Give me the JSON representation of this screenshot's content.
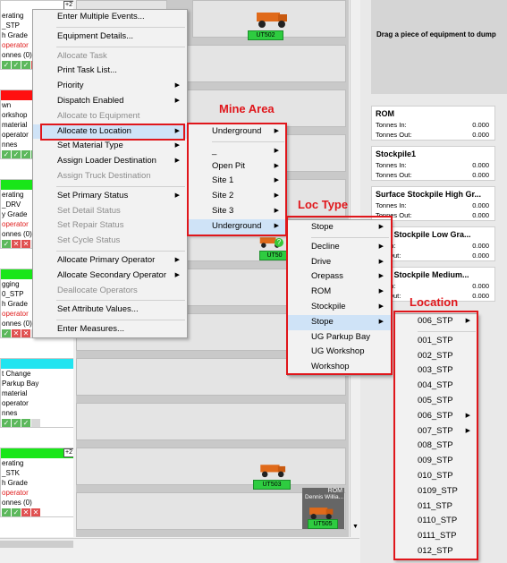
{
  "left_cards": [
    {
      "header_color": "#ffffff",
      "lines": [
        "erating",
        "_STP",
        "h Grade",
        "operator",
        "onnes (0)"
      ],
      "red_line": 3,
      "badge": "+2",
      "icons": [
        "g",
        "g",
        "g",
        "r"
      ]
    },
    {
      "header_color": "#ff1010",
      "lines": [
        "wn",
        "orkshop",
        "material",
        "operator",
        "nnes"
      ],
      "red_line": -1,
      "badge": "",
      "icons": [
        "g",
        "g",
        "g",
        "g"
      ]
    },
    {
      "header_color": "#19e619",
      "lines": [
        "erating",
        "_DRV",
        "y Grade",
        "operator",
        "onnes (0)"
      ],
      "red_line": 3,
      "badge": "",
      "icons": [
        "g",
        "r",
        "r",
        "w"
      ]
    },
    {
      "header_color": "#19e619",
      "lines": [
        "gging",
        "0_STP",
        "h Grade",
        "operator",
        "onnes (0)"
      ],
      "red_line": 3,
      "badge": "",
      "icons": [
        "g",
        "r",
        "r",
        "w"
      ]
    },
    {
      "header_color": "#22e4f0",
      "lines": [
        "t Change",
        "Parkup Bay",
        "material",
        "operator",
        "nnes"
      ],
      "red_line": -1,
      "badge": "",
      "icons": [
        "g",
        "g",
        "g",
        "w"
      ]
    },
    {
      "header_color": "#19e619",
      "lines": [
        "erating",
        "_STK",
        "h Grade",
        "operator",
        "onnes (0)"
      ],
      "red_line": 3,
      "badge": "+2",
      "icons": [
        "g",
        "g",
        "r",
        "r"
      ]
    }
  ],
  "trucks": [
    {
      "label": "UT502"
    },
    {
      "label": "UT50"
    },
    {
      "label": "UT503"
    },
    {
      "label": "UT505",
      "location": "ROM",
      "operator": "Dennis Willia..."
    }
  ],
  "right_panel": {
    "drag_hint": "Drag a piece of equipment to dump",
    "locations": [
      {
        "name": "ROM",
        "in_label": "Tonnes In:",
        "in": "0.000",
        "out_label": "Tonnes Out:",
        "out": "0.000"
      },
      {
        "name": "Stockpile1",
        "in_label": "Tonnes In:",
        "in": "0.000",
        "out_label": "Tonnes Out:",
        "out": "0.000"
      },
      {
        "name": "Surface Stockpile High Gr...",
        "in_label": "Tonnes In:",
        "in": "0.000",
        "out_label": "Tonnes Out:",
        "out": "0.000"
      },
      {
        "name": "face Stockpile Low Gra...",
        "in_label": "nes In:",
        "in": "0.000",
        "out_label": "nes Out:",
        "out": "0.000"
      },
      {
        "name": "face Stockpile Medium...",
        "in_label": "nes In:",
        "in": "0.000",
        "out_label": "nes Out:",
        "out": "0.000"
      }
    ]
  },
  "context_menu": {
    "items": [
      {
        "label": "Enter Multiple Events...",
        "disabled": false,
        "arrow": false
      },
      {
        "sep": true
      },
      {
        "label": "Equipment Details...",
        "disabled": false,
        "arrow": false
      },
      {
        "sep": true
      },
      {
        "label": "Allocate Task",
        "disabled": true,
        "arrow": false
      },
      {
        "label": "Print Task List...",
        "disabled": false,
        "arrow": false
      },
      {
        "label": "Priority",
        "disabled": false,
        "arrow": true
      },
      {
        "label": "Dispatch Enabled",
        "disabled": false,
        "arrow": true
      },
      {
        "label": "Allocate to Equipment",
        "disabled": true,
        "arrow": false
      },
      {
        "label": "Allocate to Location",
        "disabled": false,
        "arrow": true,
        "selected": true
      },
      {
        "label": "Set Material Type",
        "disabled": false,
        "arrow": true
      },
      {
        "label": "Assign Loader Destination",
        "disabled": false,
        "arrow": true
      },
      {
        "label": "Assign Truck Destination",
        "disabled": true,
        "arrow": false
      },
      {
        "sep": true
      },
      {
        "label": "Set Primary Status",
        "disabled": false,
        "arrow": true
      },
      {
        "label": "Set Detail Status",
        "disabled": true,
        "arrow": false
      },
      {
        "label": "Set Repair Status",
        "disabled": true,
        "arrow": false
      },
      {
        "label": "Set Cycle Status",
        "disabled": true,
        "arrow": false
      },
      {
        "sep": true
      },
      {
        "label": "Allocate Primary Operator",
        "disabled": false,
        "arrow": true
      },
      {
        "label": "Allocate Secondary Operator",
        "disabled": false,
        "arrow": true
      },
      {
        "label": "Deallocate Operators",
        "disabled": true,
        "arrow": false
      },
      {
        "sep": true
      },
      {
        "label": "Set Attribute Values...",
        "disabled": false,
        "arrow": false
      },
      {
        "sep": true
      },
      {
        "label": "Enter Measures...",
        "disabled": false,
        "arrow": false
      }
    ]
  },
  "mine_area_menu": {
    "annotation": "Mine Area",
    "items": [
      {
        "label": "Underground",
        "arrow": true
      },
      {
        "sep": true
      },
      {
        "label": "_",
        "arrow": true
      },
      {
        "label": "Open Pit",
        "arrow": true
      },
      {
        "label": "Site 1",
        "arrow": true
      },
      {
        "label": "Site 2",
        "arrow": true
      },
      {
        "label": "Site 3",
        "arrow": true
      },
      {
        "label": "Underground",
        "arrow": true,
        "selected": true
      }
    ]
  },
  "loc_type_menu": {
    "annotation": "Loc Type",
    "items": [
      {
        "label": "Stope",
        "arrow": true
      },
      {
        "sep": true
      },
      {
        "label": "Decline",
        "arrow": true
      },
      {
        "label": "Drive",
        "arrow": true
      },
      {
        "label": "Orepass",
        "arrow": true
      },
      {
        "label": "ROM",
        "arrow": true
      },
      {
        "label": "Stockpile",
        "arrow": true
      },
      {
        "label": "Stope",
        "arrow": true,
        "selected": true
      },
      {
        "label": "UG Parkup Bay",
        "arrow": false
      },
      {
        "label": "UG Workshop",
        "arrow": false
      },
      {
        "label": "Workshop",
        "arrow": false
      }
    ]
  },
  "location_menu": {
    "annotation": "Location",
    "items": [
      {
        "label": "006_STP",
        "arrow": true
      },
      {
        "sep": true
      },
      {
        "label": "001_STP",
        "arrow": false
      },
      {
        "label": "002_STP",
        "arrow": false
      },
      {
        "label": "003_STP",
        "arrow": false
      },
      {
        "label": "004_STP",
        "arrow": false
      },
      {
        "label": "005_STP",
        "arrow": false
      },
      {
        "label": "006_STP",
        "arrow": true
      },
      {
        "label": "007_STP",
        "arrow": true
      },
      {
        "label": "008_STP",
        "arrow": false
      },
      {
        "label": "009_STP",
        "arrow": false
      },
      {
        "label": "010_STP",
        "arrow": false
      },
      {
        "label": "0109_STP",
        "arrow": false
      },
      {
        "label": "011_STP",
        "arrow": false
      },
      {
        "label": "0110_STP",
        "arrow": false
      },
      {
        "label": "0111_STP",
        "arrow": false
      },
      {
        "label": "012_STP",
        "arrow": false
      }
    ]
  },
  "colors": {
    "annotation_red": "#e0161b",
    "status_green": "#19e619",
    "menu_highlight": "#cfe3f7"
  }
}
